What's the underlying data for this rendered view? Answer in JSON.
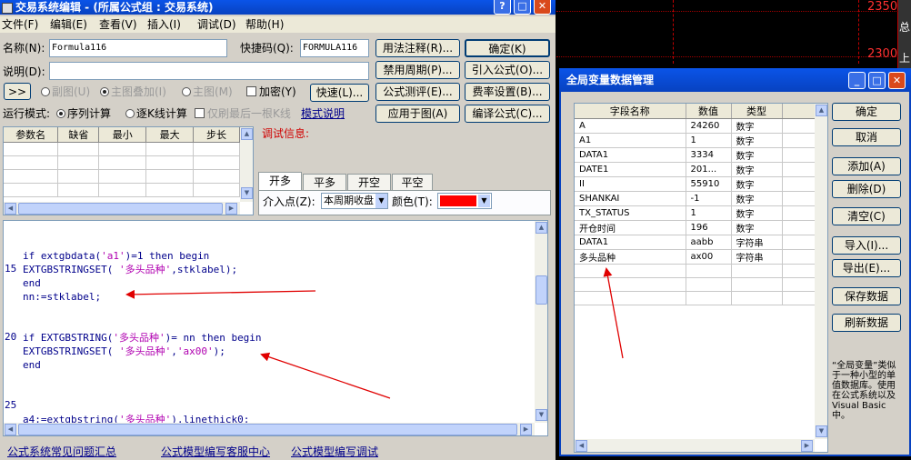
{
  "chart_bg": {
    "price_labels": [
      "2350",
      "2300"
    ],
    "side_glyphs": [
      "总",
      "上"
    ]
  },
  "editor": {
    "title": "交易系统编辑 - (所属公式组 : 交易系统)",
    "menu": [
      "文件(F)",
      "编辑(E)",
      "查看(V)",
      "插入(I)",
      "调试(D)",
      "帮助(H)"
    ],
    "name_label": "名称(N):",
    "name_value": "Formula116",
    "shortcut_label": "快捷码(Q):",
    "shortcut_value": "FORMULA116",
    "btn_usage": "用法注释(R)...",
    "btn_ok": "确定(K)",
    "desc_label": "说明(D):",
    "btn_disable_period": "禁用周期(P)...",
    "btn_import": "引入公式(O)...",
    "btn_expand": ">>",
    "opt_subchart": "副图(U)",
    "opt_overlay": "主图叠加(I)",
    "opt_mainchart": "主图(M)",
    "opt_encrypt": "加密(Y)",
    "btn_quick": "快速(L)...",
    "btn_test": "公式测评(E)...",
    "btn_fee": "费率设置(B)...",
    "run_mode_label": "运行模式:",
    "run_seq": "序列计算",
    "run_kline": "逐K线计算",
    "run_last": "仅刷最后一根K线",
    "mode_help": "模式说明",
    "btn_apply": "应用于图(A)",
    "btn_compile": "编译公式(C)...",
    "param_headers": [
      "参数名",
      "缺省",
      "最小",
      "最大",
      "步长"
    ],
    "debug_label": "调试信息:",
    "tabs": [
      "开多",
      "平多",
      "开空",
      "平空"
    ],
    "entry_label": "介入点(Z):",
    "entry_value": "本周期收盘",
    "color_label": "颜色(T):",
    "color_value": "#ff0000",
    "code_lines": [
      {
        "num": "",
        "segs": [
          [
            "if extgbdata(",
            "kw"
          ],
          [
            "'a1'",
            "str"
          ],
          [
            ")=1 then begin",
            "kw"
          ]
        ]
      },
      {
        "num": "15",
        "segs": [
          [
            "EXTGBSTRINGSET( ",
            "kw"
          ],
          [
            "'多头品种'",
            "str"
          ],
          [
            ",stklabel);",
            "kw"
          ]
        ]
      },
      {
        "num": "",
        "segs": [
          [
            "end",
            "kw"
          ]
        ]
      },
      {
        "num": "",
        "segs": [
          [
            "nn:=stklabel;",
            "kw"
          ]
        ]
      },
      {
        "num": "",
        "segs": []
      },
      {
        "num": "",
        "segs": []
      },
      {
        "num": "20",
        "segs": [
          [
            "if EXTGBSTRING(",
            "kw"
          ],
          [
            "'多头品种'",
            "str"
          ],
          [
            ")= nn then begin",
            "kw"
          ]
        ]
      },
      {
        "num": "",
        "segs": [
          [
            "EXTGBSTRINGSET( ",
            "kw"
          ],
          [
            "'多头品种'",
            "str"
          ],
          [
            ",",
            "kw"
          ],
          [
            "'ax00'",
            "str"
          ],
          [
            ");",
            "kw"
          ]
        ]
      },
      {
        "num": "",
        "segs": [
          [
            "end",
            "kw"
          ]
        ]
      },
      {
        "num": "",
        "segs": []
      },
      {
        "num": "",
        "segs": []
      },
      {
        "num": "25",
        "segs": []
      },
      {
        "num": "",
        "segs": [
          [
            "a4:=extgbstring(",
            "kw"
          ],
          [
            "'多头品种'",
            "str"
          ],
          [
            "),linethick0;",
            "kw"
          ]
        ]
      }
    ],
    "footer_links": [
      "公式系统常见问题汇总",
      "公式模型编写客服中心",
      "公式模型编写调试"
    ]
  },
  "globals": {
    "title": "全局变量数据管理",
    "headers": [
      "字段名称",
      "数值",
      "类型"
    ],
    "rows": [
      [
        "A",
        "24260",
        "数字"
      ],
      [
        "A1",
        "1",
        "数字"
      ],
      [
        "DATA1",
        "3334",
        "数字"
      ],
      [
        "DATE1",
        "201...",
        "数字"
      ],
      [
        "II",
        "55910",
        "数字"
      ],
      [
        "SHANKAI",
        "-1",
        "数字"
      ],
      [
        "TX_STATUS",
        "1",
        "数字"
      ],
      [
        "开仓时间",
        "196",
        "数字"
      ],
      [
        "DATA1",
        "aabb",
        "字符串"
      ],
      [
        "多头品种",
        "ax00",
        "字符串"
      ]
    ],
    "buttons": [
      "确定",
      "取消",
      "添加(A)",
      "删除(D)",
      "清空(C)",
      "导入(I)...",
      "导出(E)...",
      "保存数据",
      "刷新数据"
    ],
    "description": "“全局变量”类似于一种小型的单值数据库。使用在公式系统以及Visual Basic中。"
  }
}
